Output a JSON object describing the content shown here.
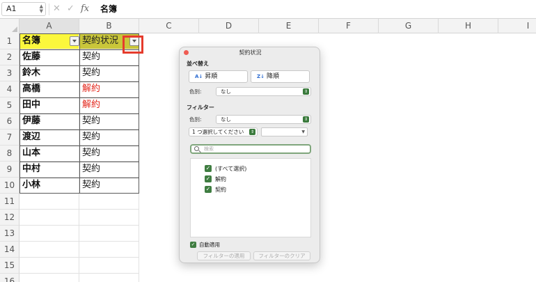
{
  "formula_bar": {
    "name_box": "A1",
    "cancel_icon": "✕",
    "confirm_icon": "✓",
    "fx_label": "fx",
    "content": "名簿"
  },
  "columns": [
    "A",
    "B",
    "C",
    "D",
    "E",
    "F",
    "G",
    "H",
    "I"
  ],
  "rows": [
    {
      "num": "1",
      "a": "名簿",
      "b": "契約状況"
    },
    {
      "num": "2",
      "a": "佐藤",
      "b": "契約"
    },
    {
      "num": "3",
      "a": "鈴木",
      "b": "契約"
    },
    {
      "num": "4",
      "a": "高橋",
      "b": "解約"
    },
    {
      "num": "5",
      "a": "田中",
      "b": "解約"
    },
    {
      "num": "6",
      "a": "伊藤",
      "b": "契約"
    },
    {
      "num": "7",
      "a": "渡辺",
      "b": "契約"
    },
    {
      "num": "8",
      "a": "山本",
      "b": "契約"
    },
    {
      "num": "9",
      "a": "中村",
      "b": "契約"
    },
    {
      "num": "10",
      "a": "小林",
      "b": "契約"
    },
    {
      "num": "11",
      "a": "",
      "b": ""
    },
    {
      "num": "12",
      "a": "",
      "b": ""
    },
    {
      "num": "13",
      "a": "",
      "b": ""
    },
    {
      "num": "14",
      "a": "",
      "b": ""
    },
    {
      "num": "15",
      "a": "",
      "b": ""
    },
    {
      "num": "16",
      "a": "",
      "b": ""
    }
  ],
  "colors": {
    "header_a_bg": "#fbf73c",
    "header_b_bg": "#c9c63a",
    "cancel_text": "#e3261b",
    "highlight_border": "#e53b2c",
    "checkbox_green": "#3f7d41"
  },
  "filter_dialog": {
    "title": "契約状況",
    "sort_section": "並べ替え",
    "sort_asc": "昇順",
    "sort_desc": "降順",
    "sort_color_label": "色別:",
    "sort_color_value": "なし",
    "filter_section": "フィルター",
    "filter_color_label": "色別:",
    "filter_color_value": "なし",
    "condition_select": "1 つ選択してください",
    "search_placeholder": "検索",
    "items": [
      {
        "label": "(すべて選択)",
        "checked": true
      },
      {
        "label": "解約",
        "checked": true
      },
      {
        "label": "契約",
        "checked": true
      }
    ],
    "auto_apply": "自動適用",
    "auto_apply_checked": true,
    "apply_button": "フィルターの適用",
    "clear_button": "フィルターのクリア"
  }
}
